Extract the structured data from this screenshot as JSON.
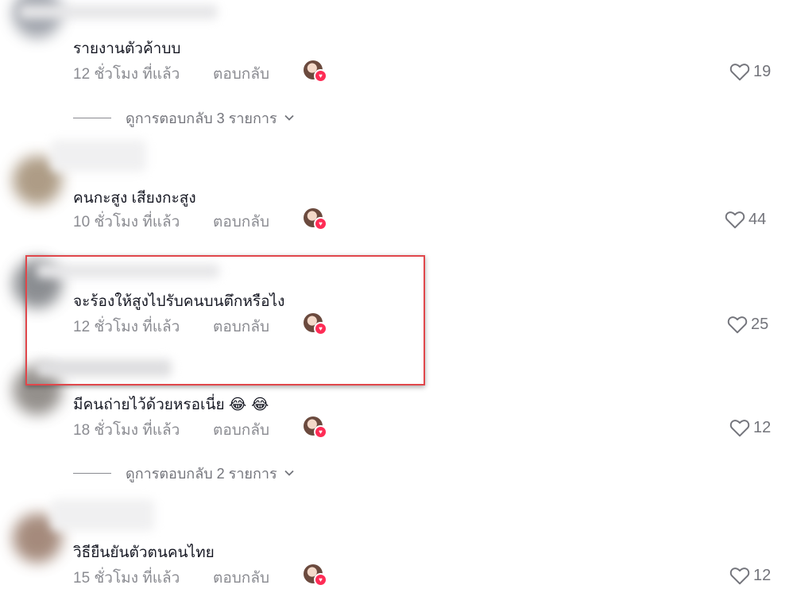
{
  "comments": [
    {
      "text": "รายงานตัวค้าบบ",
      "time": "12 ชั่วโมง ที่แล้ว",
      "reply_label": "ตอบกลับ",
      "likes": "19",
      "view_replies": "ดูการตอบกลับ 3 รายการ"
    },
    {
      "text": "คนกะสูง เสียงกะสูง",
      "time": "10 ชั่วโมง ที่แล้ว",
      "reply_label": "ตอบกลับ",
      "likes": "44"
    },
    {
      "text": "จะร้องให้สูงไปรับคนบนตึกหรือไง",
      "time": "12 ชั่วโมง ที่แล้ว",
      "reply_label": "ตอบกลับ",
      "likes": "25",
      "highlighted": true
    },
    {
      "text": "มีคนถ่ายไว้ด้วยหรอเนี่ย",
      "emoji": "😂 😂",
      "time": "18 ชั่วโมง ที่แล้ว",
      "reply_label": "ตอบกลับ",
      "likes": "12",
      "view_replies": "ดูการตอบกลับ 2 รายการ"
    },
    {
      "text": "วิธียืนยันตัวตนคนไทย",
      "time": "15 ชั่วโมง ที่แล้ว",
      "reply_label": "ตอบกลับ",
      "likes": "12"
    }
  ],
  "icons": {
    "like": "heart-outline-icon",
    "expand": "chevron-down-icon",
    "creator_liked": "creator-avatar-heart-badge"
  },
  "colors": {
    "text": "#161823",
    "secondary": "#8a8b91",
    "accent": "#fe2c55",
    "highlight": "#e0474b"
  }
}
